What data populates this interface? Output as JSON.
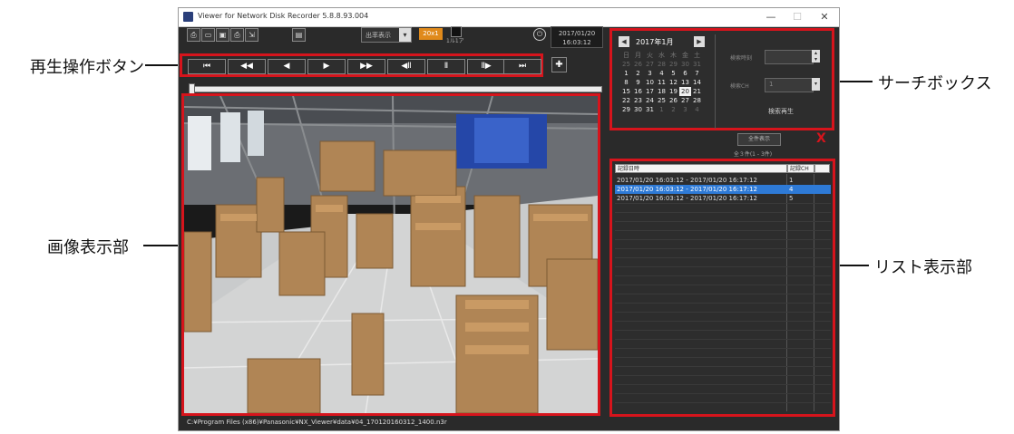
{
  "callouts": {
    "playback": "再生操作ボタン",
    "image": "画像表示部",
    "search": "サーチボックス",
    "list": "リスト表示部"
  },
  "window": {
    "title": "Viewer for Network Disk Recorder 5.8.8.93.004",
    "min": "—",
    "max": "☐",
    "close": "✕"
  },
  "toolbar": {
    "icons": [
      "print-icon",
      "open-folder-icon",
      "save-icon",
      "printer-icon",
      "export-icon",
      "screen-icon"
    ],
    "dropdown_label": "出率表示",
    "dropdown_arrow": "▾",
    "speed": "20x1",
    "toggle_label": "1ル1ア",
    "clock": "⏻",
    "date": "2017/01/20",
    "time": "16:03:12"
  },
  "playback_buttons": [
    "⏮",
    "◀◀",
    "◀",
    "▶",
    "▶▶",
    "◀Ⅱ",
    "Ⅱ",
    "Ⅱ▶",
    "⏭"
  ],
  "calendar": {
    "title": "2017年1月",
    "prev": "◀",
    "next": "▶",
    "weekdays": [
      "日",
      "月",
      "火",
      "水",
      "木",
      "金",
      "土"
    ],
    "weeks": [
      [
        "25",
        "26",
        "27",
        "28",
        "29",
        "30",
        "31"
      ],
      [
        "1",
        "2",
        "3",
        "4",
        "5",
        "6",
        "7"
      ],
      [
        "8",
        "9",
        "10",
        "11",
        "12",
        "13",
        "14"
      ],
      [
        "15",
        "16",
        "17",
        "18",
        "19",
        "20",
        "21"
      ],
      [
        "22",
        "23",
        "24",
        "25",
        "26",
        "27",
        "28"
      ],
      [
        "29",
        "30",
        "31",
        "1",
        "2",
        "3",
        "4"
      ]
    ],
    "highlight_day": "20"
  },
  "search": {
    "time_label": "検索時刻",
    "ch_label": "検索CH",
    "ch_value": "1",
    "play_button": "検索再生"
  },
  "list": {
    "show_all": "全件表示",
    "close": "X",
    "count": "全３件(1 - 3件)",
    "header_time": "記録日時",
    "header_ch": "記録CH",
    "rows": [
      {
        "time": "2017/01/20 16:03:12 - 2017/01/20 16:17:12",
        "ch": "1"
      },
      {
        "time": "2017/01/20 16:03:12 - 2017/01/20 16:17:12",
        "ch": "4"
      },
      {
        "time": "2017/01/20 16:03:12 - 2017/01/20 16:17:12",
        "ch": "5"
      }
    ],
    "selected_index": 1
  },
  "filepath": "C:¥Program Files (x86)¥Panasonic¥NX_Viewer¥data¥04_170120160312_1400.n3r",
  "colors": {
    "highlight_red": "#d6141c",
    "accent_orange": "#e08a1b",
    "selection_blue": "#2e7ad6",
    "window_bg": "#2a2a2a"
  }
}
